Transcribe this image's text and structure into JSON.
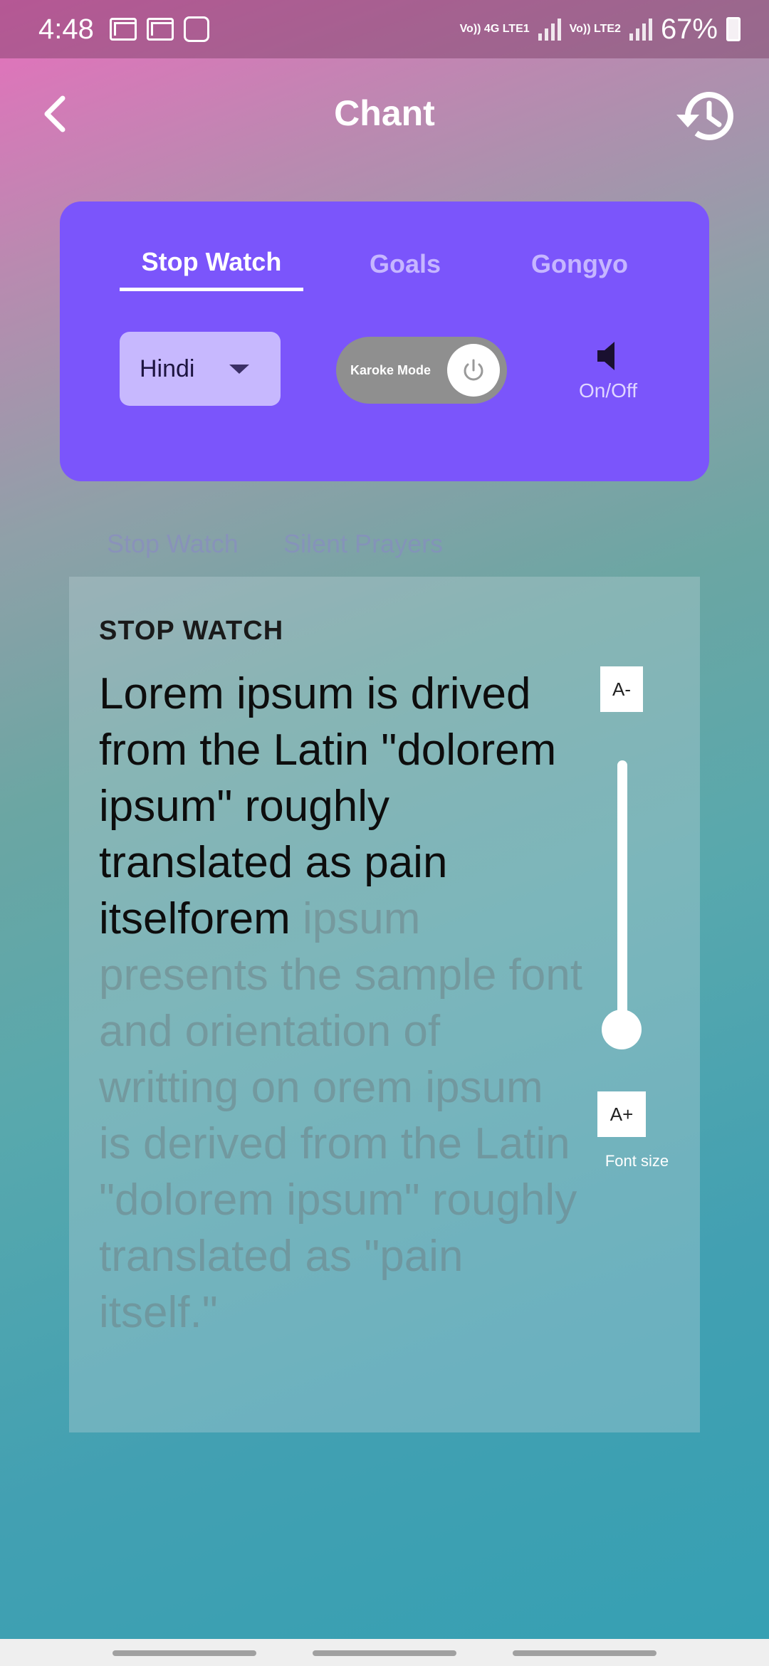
{
  "status_bar": {
    "time": "4:48",
    "sim1": "Vo)) 4G LTE1",
    "sim2": "Vo)) LTE2",
    "battery": "67%"
  },
  "header": {
    "title": "Chant",
    "back_icon": "chevron-left-icon",
    "history_icon": "history-icon"
  },
  "tabs": [
    {
      "label": "Stop Watch",
      "active": true
    },
    {
      "label": "Goals",
      "active": false
    },
    {
      "label": "Gongyo",
      "active": false
    }
  ],
  "language": {
    "selected": "Hindi"
  },
  "karoke": {
    "label": "Karoke Mode",
    "on": false
  },
  "sound": {
    "label": "On/Off"
  },
  "sub_tabs": [
    {
      "label": "Stop Watch"
    },
    {
      "label": "Silent Prayers"
    }
  ],
  "panel": {
    "heading": "STOP WATCH",
    "text_read": "Lorem ipsum is drived from the Latin \"dolorem ipsum\" roughly translated as pain itselforem",
    "text_unread": " ipsum presents the sample font and orientation of writting on orem ipsum is derived from the Latin \"dolorem ipsum\" roughly translated as \"pain itself.\""
  },
  "font_size": {
    "decrease_label": "A-",
    "increase_label": "A+",
    "label": "Font size",
    "level": 0.0
  },
  "colors": {
    "card_purple": "#7b55fb",
    "select_lavender": "#c7b8fe",
    "toggle_gray": "#8f8f8f"
  }
}
